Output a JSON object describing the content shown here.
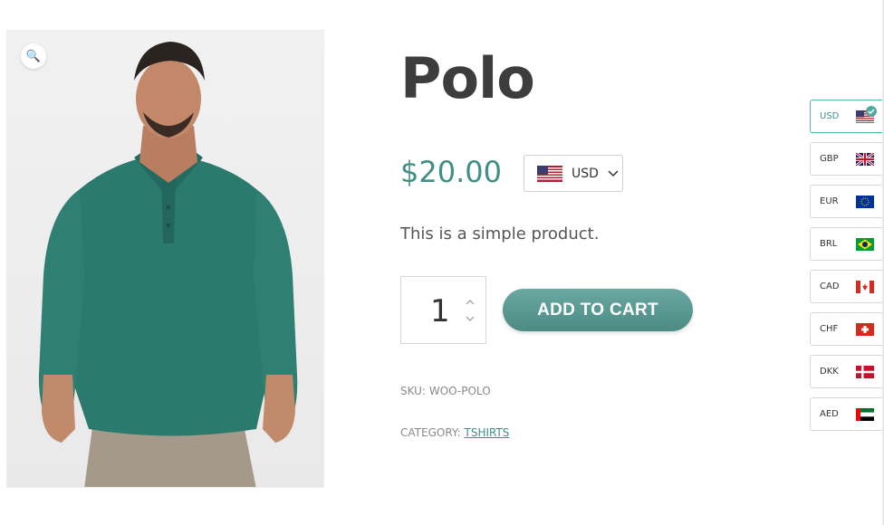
{
  "product": {
    "title": "Polo",
    "price": "$20.00",
    "description": "This is a simple product.",
    "quantity": "1",
    "add_to_cart_label": "ADD TO CART",
    "sku_label": "SKU:",
    "sku_value": "WOO-POLO",
    "category_label": "CATEGORY:",
    "category_value": "TSHIRTS",
    "zoom_icon": "magnifier-icon"
  },
  "currency_select": {
    "selected": "USD",
    "flag": "us-flag-icon"
  },
  "currency_switcher": {
    "items": [
      {
        "code": "USD",
        "flag": "us-flag-icon",
        "active": true
      },
      {
        "code": "GBP",
        "flag": "uk-flag-icon",
        "active": false
      },
      {
        "code": "EUR",
        "flag": "eu-flag-icon",
        "active": false
      },
      {
        "code": "BRL",
        "flag": "br-flag-icon",
        "active": false
      },
      {
        "code": "CAD",
        "flag": "ca-flag-icon",
        "active": false
      },
      {
        "code": "CHF",
        "flag": "ch-flag-icon",
        "active": false
      },
      {
        "code": "DKK",
        "flag": "dk-flag-icon",
        "active": false
      },
      {
        "code": "AED",
        "flag": "ae-flag-icon",
        "active": false
      }
    ]
  },
  "colors": {
    "accent": "#3f8f86",
    "button": "#5a9a93",
    "shirt": "#2a7a6d"
  }
}
